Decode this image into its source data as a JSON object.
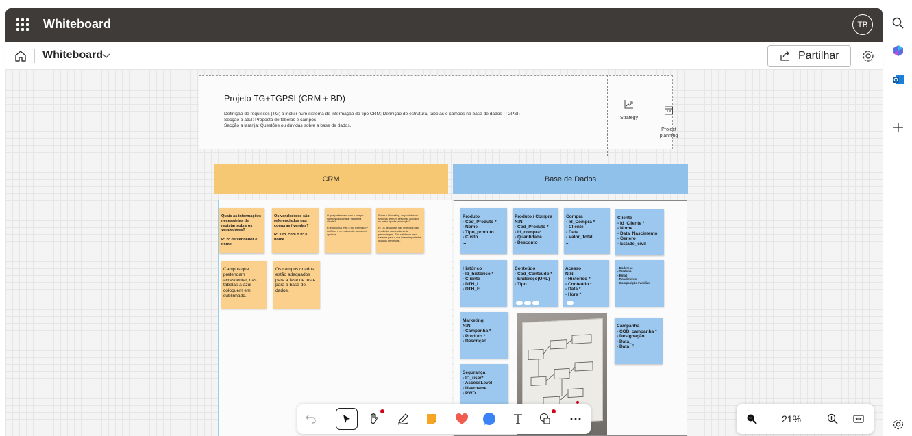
{
  "app": {
    "title": "Whiteboard",
    "avatar_initials": "TB"
  },
  "toolbar": {
    "board_name": "Whiteboard",
    "share_label": "Partilhar"
  },
  "header": {
    "title": "Projeto TG+TGPSI (CRM + BD)",
    "lines": [
      "Definição de requisitos (TG) a incluir num sistema de informação do tipo CRM; Definição de estrutura, tabelas e campos na base de dados (TGPSI)",
      "Secção a azul: Proposta de tabelas e campos",
      "Secção a laranja: Questões ou dúvidas sobre a base de dados."
    ],
    "tiles": [
      {
        "label": "Strategy",
        "icon": "chart-icon"
      },
      {
        "label": "Project\nplanning",
        "icon": "calendar-icon"
      }
    ]
  },
  "sections": {
    "crm": "CRM",
    "bd": "Base de Dados"
  },
  "crm_notes": [
    {
      "text": "Quais as informações necessárias de registar sobre os vendedores?\n\nR: nº de vendedor e nome"
    },
    {
      "text": "Os vendedores são referenciados nas compras / vendas?\n\nR: sim, com o nº e nome."
    },
    {
      "text": "O que pretendem com o campo composição familiar na tabela cliente?\n\nR: é opcional mas é por exemplo nº de filhos e o rendimento também é opcional."
    },
    {
      "text": "Sobre o Marketing, os produtos ou serviços têm um desconto aplicado ou outro tipo de promoção?\n\nR: Os descontos são inseridos pelo vendedor numa coluna de percentagem. São validados pelo sistema para o que forem importados listados de vendas."
    },
    {
      "text": "Campos que pretendam acrescentar, nas tabelas a azul coloquem em ",
      "underlined": "sublinhado."
    },
    {
      "text": "Os campos criados estão adequados para a fase de teste para a base de dados."
    }
  ],
  "bd_notes": [
    {
      "text": "Produto\n- Cod_Produto *\n- Nome\n- Tipo_produto\n- Custo\n..."
    },
    {
      "text": "Produto / Compra\nN:N\n- Cod_Produto *\n- Id_compra*\n- Quantidade\n- Desconto"
    },
    {
      "text": "Compra\n- Id_Compra *\n- Cliente\n- Data\n- Valor_Total\n..."
    },
    {
      "text": "Cliente\n- Id_Cliente *\n- Nome\n- Data_Nascimento\n- Genero\n- Estado_civil"
    },
    {
      "text": "Histórico\n- Id_histórico *\n- Cliente\n- DTH_I\n- DTH_F"
    },
    {
      "text": "Conteúdo\n- Cod_Conteúdo *\n- Endereço(URL)\n- Tipo"
    },
    {
      "text": "Acesso\nN:N\n- Histórico *\n- Conteúdo *\n- Data *\n- Hora *"
    },
    {
      "text": "- Endereço\n- Telefone\n- Email\n- Rendimento\n- Composição Familiar\n..."
    },
    {
      "text": "Marketing\nN:N\n- Campanha *\n- Produto *\n- Descrição"
    },
    {
      "text": "Campanha\n- COD_campanha *\n- Designação\n- Data_I\n- Data_F"
    },
    {
      "text": "Segurança\n- ID_user*\n- AccessLevel\n- Username\n- PWD"
    }
  ],
  "zoom": {
    "level": "21%"
  },
  "colors": {
    "titlebar": "#3f3b39",
    "crm": "#f6c874",
    "bd": "#8fc1ea",
    "orange_note": "#fad08c",
    "blue_note": "#9cc8ef",
    "accent_dot": "#d0021b"
  }
}
